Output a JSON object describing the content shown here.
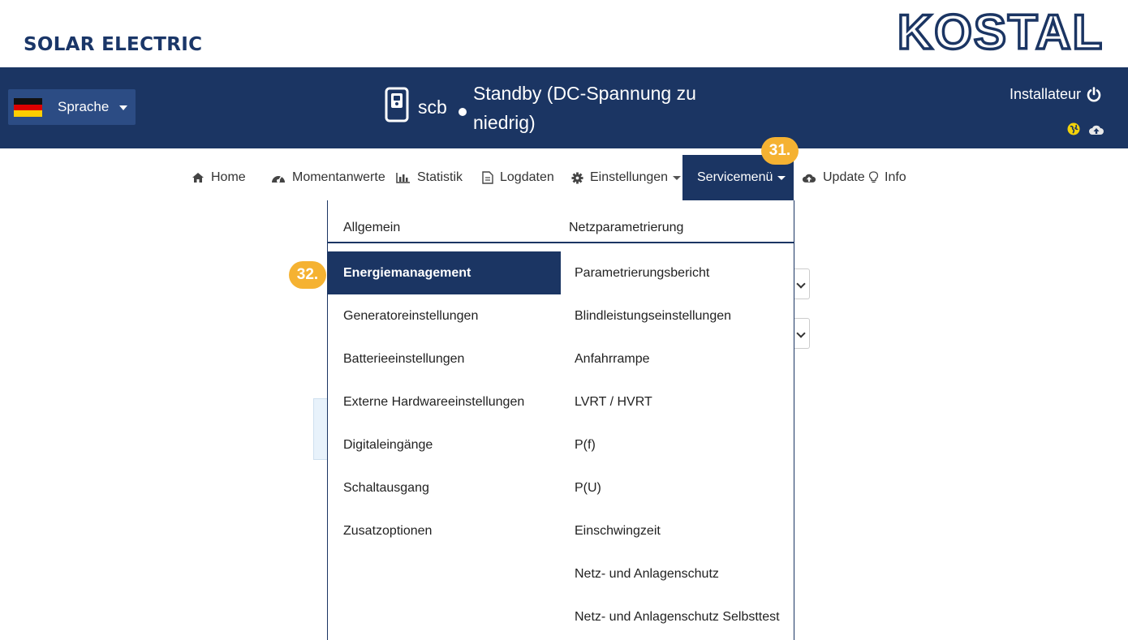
{
  "brand": {
    "tagline": "SOLAR ELECTRIC",
    "logo_text": "KOSTAL"
  },
  "header": {
    "language_label": "Sprache",
    "device_name": "scb",
    "status": "Standby (DC-Spannung zu niedrig)",
    "user_label": "Installateur"
  },
  "nav": {
    "home": "Home",
    "momentanwerte": "Momentanwerte",
    "statistik": "Statistik",
    "logdaten": "Logdaten",
    "einstellungen": "Einstellungen",
    "servicemenu": "Servicemenü",
    "update": "Update",
    "info": "Info"
  },
  "dropdown": {
    "col1_header": "Allgemein",
    "col2_header": "Netzparametrierung",
    "col1_items": [
      "Energiemanagement",
      "Generatoreinstellungen",
      "Batterieeinstellungen",
      "Externe Hardwareeinstellungen",
      "Digitaleingänge",
      "Schaltausgang",
      "Zusatzoptionen"
    ],
    "col2_items": [
      "Parametrierungsbericht",
      "Blindleistungseinstellungen",
      "Anfahrrampe",
      "LVRT / HVRT",
      "P(f)",
      "P(U)",
      "Einschwingzeit",
      "Netz- und Anlagenschutz",
      "Netz- und Anlagenschutz Selbsttest"
    ],
    "active_item": "Energiemanagement"
  },
  "annotations": {
    "step_31": "31.",
    "step_32": "32."
  },
  "colors": {
    "primary": "#1b3563",
    "badge": "#f5b232",
    "status_icon": "#f2d20a"
  }
}
